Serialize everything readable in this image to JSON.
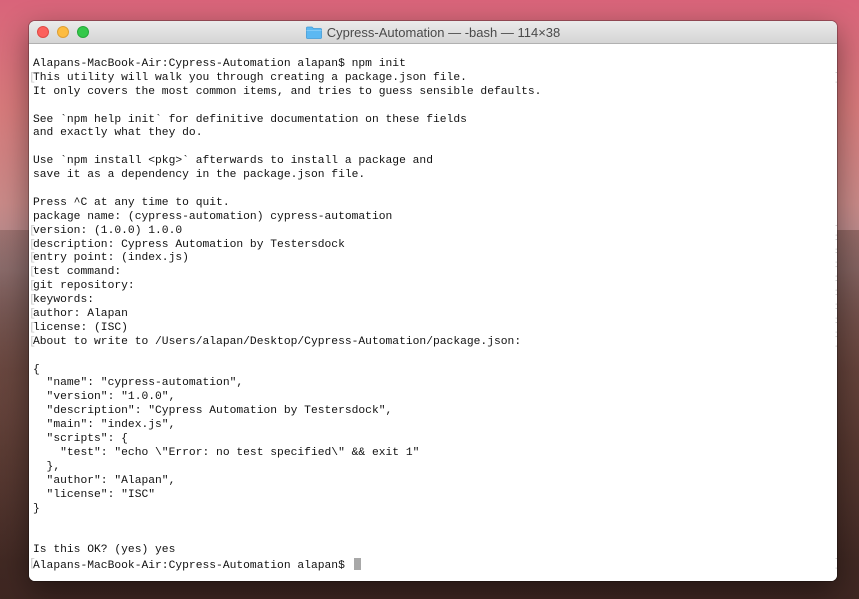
{
  "window": {
    "title": "Cypress-Automation — -bash — 114×38"
  },
  "terminal": {
    "lines": [
      {
        "text": "Alapans-MacBook-Air:Cypress-Automation alapan$ npm init",
        "bl": false,
        "br": false
      },
      {
        "text": "This utility will walk you through creating a package.json file.",
        "bl": true,
        "br": true
      },
      {
        "text": "It only covers the most common items, and tries to guess sensible defaults.",
        "bl": false,
        "br": false
      },
      {
        "text": "",
        "bl": false,
        "br": false
      },
      {
        "text": "See `npm help init` for definitive documentation on these fields",
        "bl": false,
        "br": false
      },
      {
        "text": "and exactly what they do.",
        "bl": false,
        "br": false
      },
      {
        "text": "",
        "bl": false,
        "br": false
      },
      {
        "text": "Use `npm install <pkg>` afterwards to install a package and",
        "bl": false,
        "br": false
      },
      {
        "text": "save it as a dependency in the package.json file.",
        "bl": false,
        "br": false
      },
      {
        "text": "",
        "bl": false,
        "br": false
      },
      {
        "text": "Press ^C at any time to quit.",
        "bl": false,
        "br": false
      },
      {
        "text": "package name: (cypress-automation) cypress-automation",
        "bl": false,
        "br": false
      },
      {
        "text": "version: (1.0.0) 1.0.0",
        "bl": true,
        "br": true
      },
      {
        "text": "description: Cypress Automation by Testersdock",
        "bl": true,
        "br": true
      },
      {
        "text": "entry point: (index.js)",
        "bl": true,
        "br": true
      },
      {
        "text": "test command:",
        "bl": true,
        "br": true
      },
      {
        "text": "git repository:",
        "bl": true,
        "br": true
      },
      {
        "text": "keywords:",
        "bl": true,
        "br": true
      },
      {
        "text": "author: Alapan",
        "bl": true,
        "br": true
      },
      {
        "text": "license: (ISC)",
        "bl": true,
        "br": true
      },
      {
        "text": "About to write to /Users/alapan/Desktop/Cypress-Automation/package.json:",
        "bl": true,
        "br": true
      },
      {
        "text": "",
        "bl": false,
        "br": false
      },
      {
        "text": "{",
        "bl": false,
        "br": false
      },
      {
        "text": "  \"name\": \"cypress-automation\",",
        "bl": false,
        "br": false
      },
      {
        "text": "  \"version\": \"1.0.0\",",
        "bl": false,
        "br": false
      },
      {
        "text": "  \"description\": \"Cypress Automation by Testersdock\",",
        "bl": false,
        "br": false
      },
      {
        "text": "  \"main\": \"index.js\",",
        "bl": false,
        "br": false
      },
      {
        "text": "  \"scripts\": {",
        "bl": false,
        "br": false
      },
      {
        "text": "    \"test\": \"echo \\\"Error: no test specified\\\" && exit 1\"",
        "bl": false,
        "br": false
      },
      {
        "text": "  },",
        "bl": false,
        "br": false
      },
      {
        "text": "  \"author\": \"Alapan\",",
        "bl": false,
        "br": false
      },
      {
        "text": "  \"license\": \"ISC\"",
        "bl": false,
        "br": false
      },
      {
        "text": "}",
        "bl": false,
        "br": false
      },
      {
        "text": "",
        "bl": false,
        "br": false
      },
      {
        "text": "",
        "bl": false,
        "br": false
      },
      {
        "text": "Is this OK? (yes) yes",
        "bl": false,
        "br": false
      },
      {
        "text": "Alapans-MacBook-Air:Cypress-Automation alapan$ ",
        "bl": true,
        "br": true,
        "cursor": true
      }
    ]
  }
}
